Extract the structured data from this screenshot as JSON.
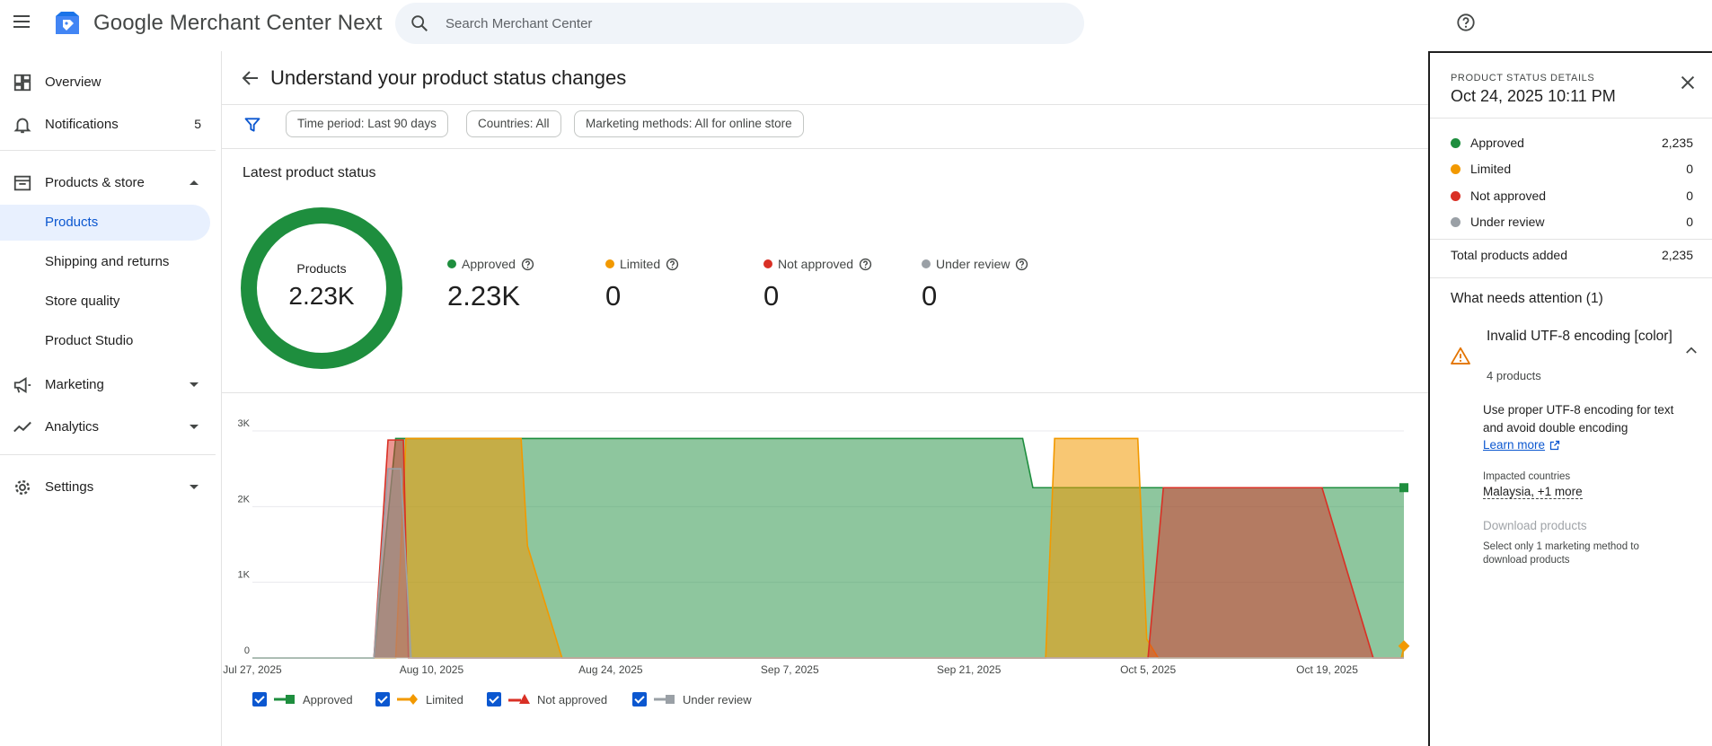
{
  "header": {
    "app_title": "Google Merchant Center Next",
    "search_placeholder": "Search Merchant Center"
  },
  "sidebar": {
    "overview": "Overview",
    "notifications": {
      "label": "Notifications",
      "count": "5"
    },
    "products_store": "Products & store",
    "sub_items": [
      "Products",
      "Shipping and returns",
      "Store quality",
      "Product Studio"
    ],
    "marketing": "Marketing",
    "analytics": "Analytics",
    "settings": "Settings"
  },
  "page": {
    "title": "Understand your product status changes",
    "filters": [
      "Time period: Last 90 days",
      "Countries: All",
      "Marketing methods: All for online store"
    ],
    "section_title": "Latest product status",
    "donut": {
      "label": "Products",
      "value": "2.23K"
    },
    "stats": [
      {
        "label": "Approved",
        "value": "2.23K",
        "color": "#1e8e3e"
      },
      {
        "label": "Limited",
        "value": "0",
        "color": "#f29900"
      },
      {
        "label": "Not approved",
        "value": "0",
        "color": "#d93025"
      },
      {
        "label": "Under review",
        "value": "0",
        "color": "#9aa0a6"
      }
    ]
  },
  "chart_data": {
    "type": "area",
    "x_tick_labels": [
      "Jul 27, 2025",
      "Aug 10, 2025",
      "Aug 24, 2025",
      "Sep 7, 2025",
      "Sep 21, 2025",
      "Oct 5, 2025",
      "Oct 19, 2025"
    ],
    "y_tick_labels": [
      "0",
      "1K",
      "2K",
      "3K"
    ],
    "ylim": [
      0,
      3000
    ],
    "x_day_index_range": [
      0,
      90
    ],
    "legend": [
      "Approved",
      "Limited",
      "Not approved",
      "Under review"
    ],
    "colors": {
      "approved": "#1e8e3e",
      "limited": "#f29900",
      "not_approved": "#d93025",
      "under_review": "#9aa0a6"
    },
    "series": [
      {
        "name": "Approved",
        "x": [
          0,
          9.5,
          11.2,
          27.2,
          28,
          54.8,
          55.6,
          60.2,
          61,
          69.8,
          70.7,
          88.2,
          89,
          90
        ],
        "values": [
          0,
          0,
          2900,
          2900,
          2900,
          2900,
          2900,
          2900,
          2250,
          2250,
          2250,
          2250,
          2250,
          2250
        ]
      },
      {
        "name": "Limited",
        "x": [
          9.5,
          11.2,
          12,
          19.6,
          21,
          21.5,
          24.2,
          25,
          25.8,
          62,
          62.7,
          69.2,
          69.9,
          70.8,
          87.4,
          88.2,
          89.8,
          90
        ],
        "values": [
          0,
          0,
          2900,
          2900,
          2900,
          1480,
          0,
          0,
          0,
          0,
          2900,
          2900,
          250,
          0,
          0,
          0,
          0,
          150
        ]
      },
      {
        "name": "Not approved",
        "x": [
          9.5,
          10.6,
          11.8,
          12.2,
          68.8,
          70,
          71.2,
          75.5,
          82.8,
          83.6,
          87.6,
          89,
          90
        ],
        "values": [
          0,
          2880,
          2880,
          0,
          0,
          0,
          2250,
          2250,
          2250,
          2250,
          0,
          0,
          0
        ]
      },
      {
        "name": "Under review",
        "x": [
          0,
          9.5,
          10.6,
          11.6,
          12.4,
          90
        ],
        "values": [
          0,
          0,
          2500,
          2500,
          0,
          0
        ]
      }
    ]
  },
  "panel": {
    "eyebrow": "PRODUCT STATUS DETAILS",
    "title": "Oct 24, 2025 10:11 PM",
    "rows": [
      {
        "label": "Approved",
        "value": "2,235",
        "color": "#1e8e3e"
      },
      {
        "label": "Limited",
        "value": "0",
        "color": "#f29900"
      },
      {
        "label": "Not approved",
        "value": "0",
        "color": "#d93025"
      },
      {
        "label": "Under review",
        "value": "0",
        "color": "#9aa0a6"
      }
    ],
    "total_label": "Total products added",
    "total_value": "2,235",
    "attention_title": "What needs attention (1)",
    "issue": {
      "title": "Invalid UTF-8 encoding [color]",
      "count": "4 products",
      "description": "Use proper UTF-8 encoding for text and avoid double encoding",
      "learn_more": "Learn more",
      "impacted_label": "Impacted countries",
      "impacted_value": "Malaysia, +1 more",
      "download": "Download products",
      "download_note": "Select only 1 marketing method to download products"
    }
  }
}
